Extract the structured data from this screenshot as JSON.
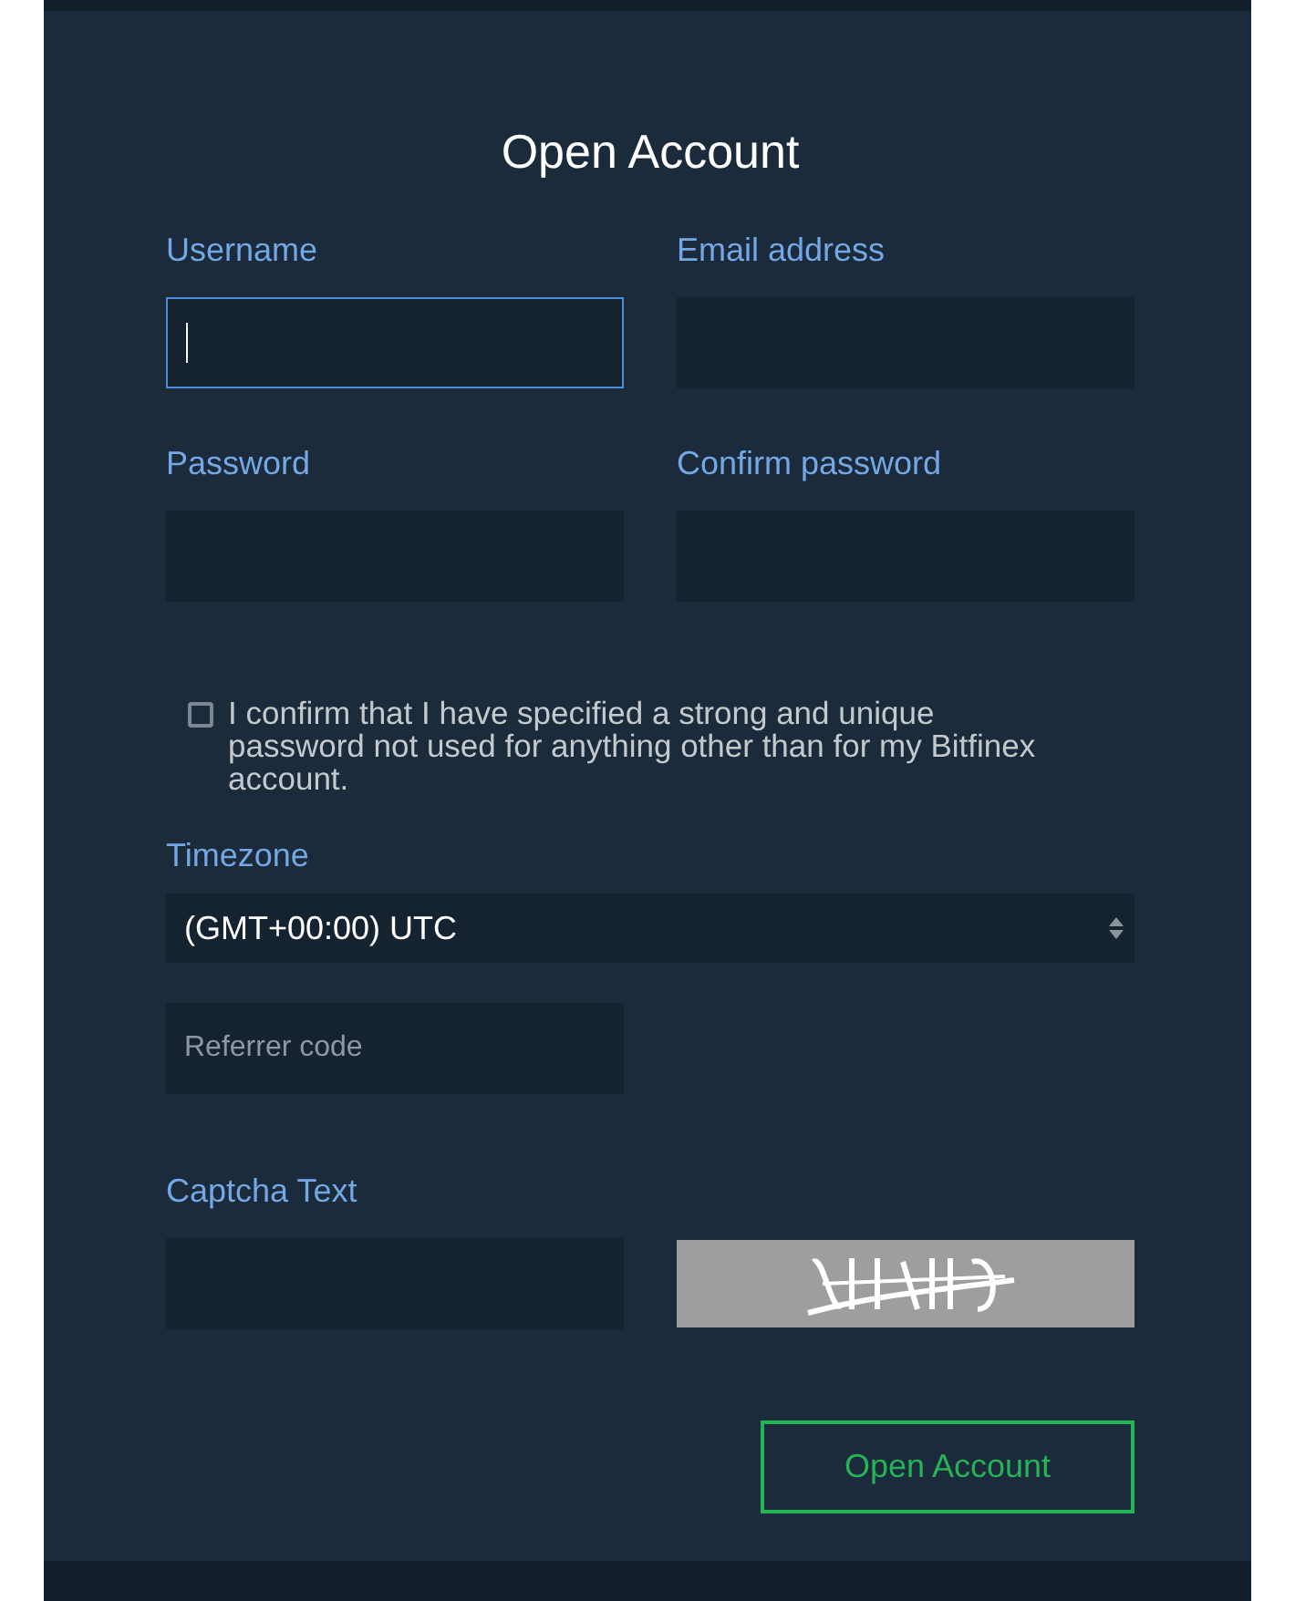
{
  "title": "Open Account",
  "fields": [
    {
      "label": "Username",
      "focused": true
    },
    {
      "label": "Email address",
      "focused": false
    },
    {
      "label": "Password",
      "focused": false
    },
    {
      "label": "Confirm password",
      "focused": false
    }
  ],
  "confirm": {
    "checked": false,
    "text": "I confirm that I have specified a strong and unique password not used for anything other than for my Bitfinex account."
  },
  "timezone": {
    "label": "Timezone",
    "value": "(GMT+00:00) UTC"
  },
  "referrer": {
    "placeholder": "Referrer code"
  },
  "captcha": {
    "label": "Captcha Text"
  },
  "submit": "Open Account"
}
